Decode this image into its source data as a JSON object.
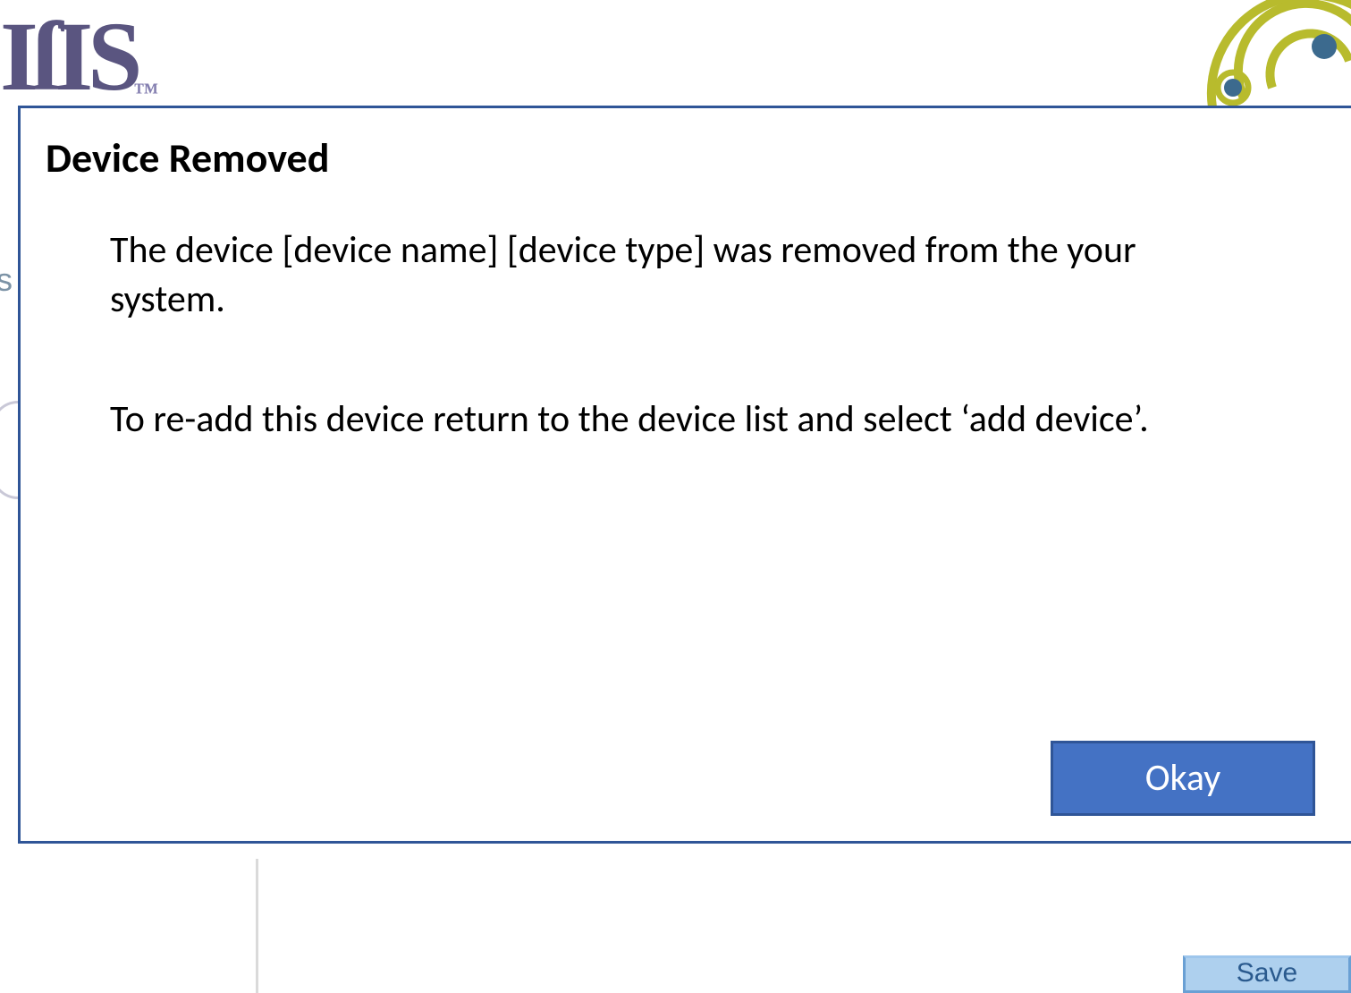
{
  "background": {
    "logo_text": "IſIS",
    "logo_tm": "™",
    "left_char": "s",
    "save_label": "Save"
  },
  "dialog": {
    "title": "Device Removed",
    "body": {
      "paragraph_1": "The device [device name] [device type] was removed from the your system.",
      "paragraph_2": "To re-add this device return to the device list and select ‘add device’."
    },
    "okay_label": "Okay"
  },
  "colors": {
    "dialog_border": "#2f5597",
    "button_fill": "#4472c4",
    "accent_olive": "#b5b82e",
    "accent_dot": "#3c6a8e"
  }
}
